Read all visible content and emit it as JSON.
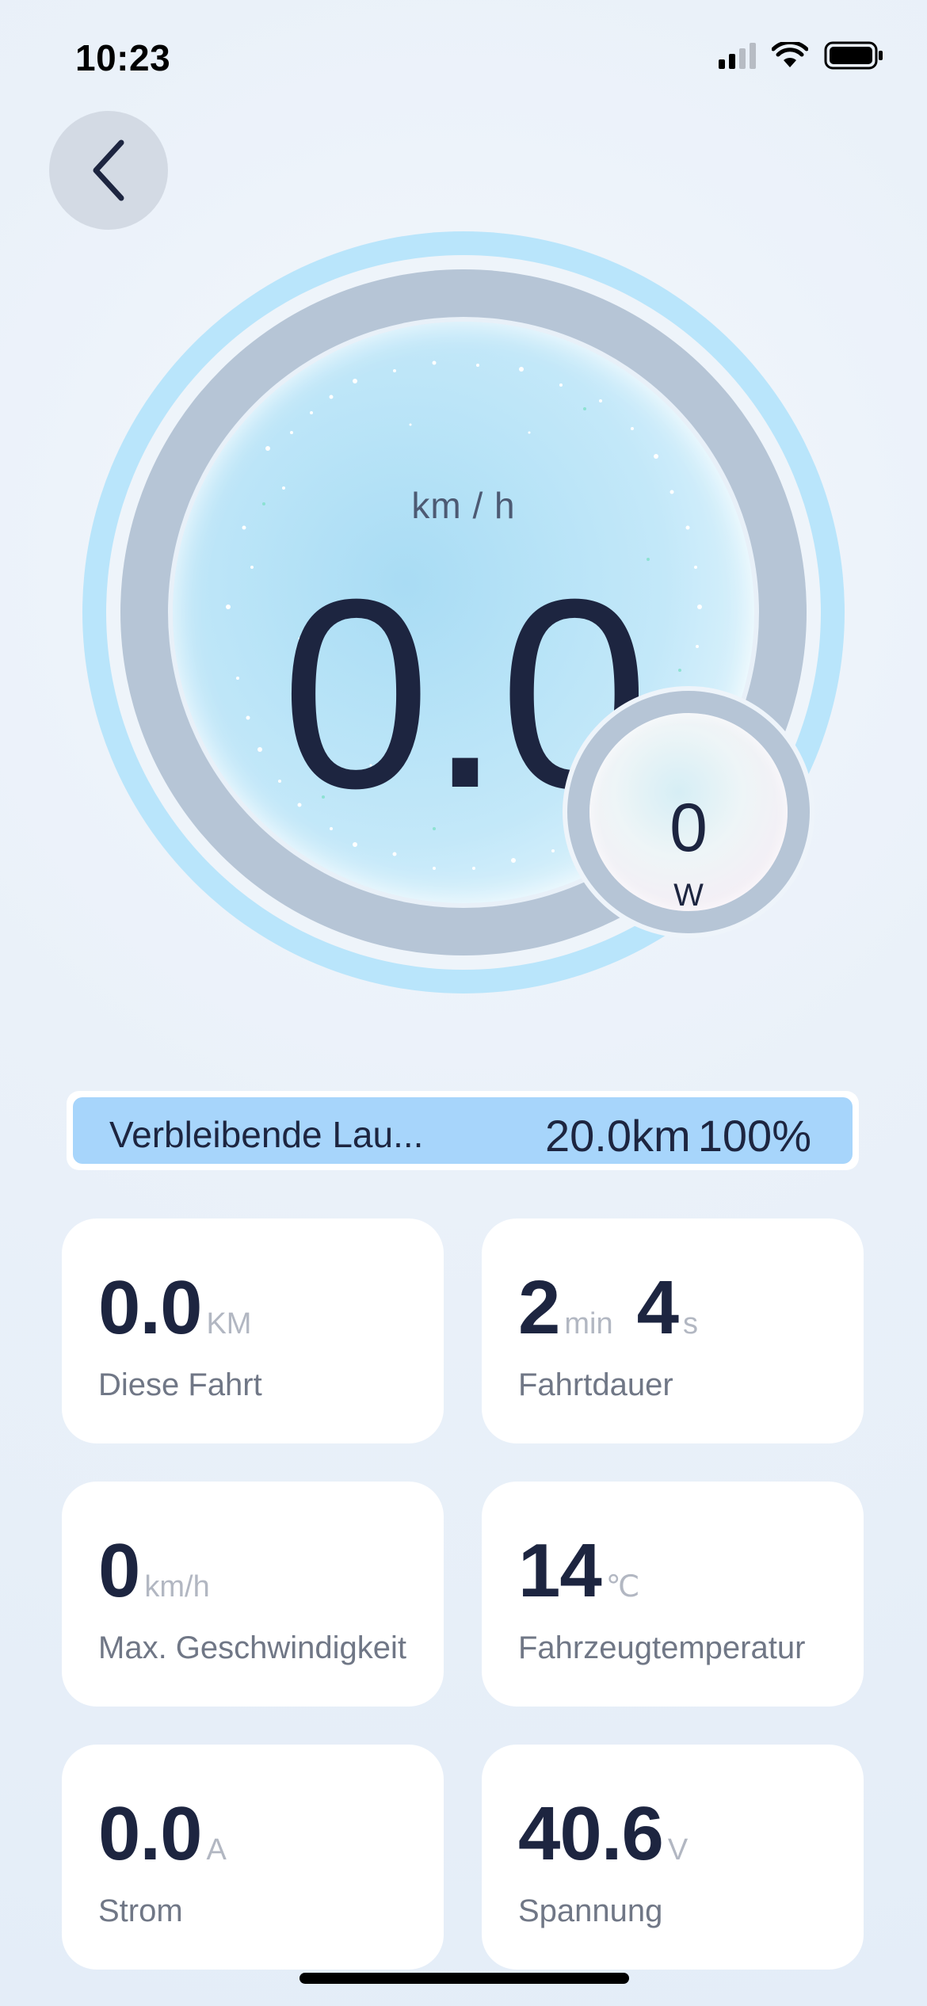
{
  "status_bar": {
    "time": "10:23"
  },
  "navigation": {
    "back_icon": "chevron-left-icon"
  },
  "speedometer": {
    "unit": "km / h",
    "value": "0.0"
  },
  "power": {
    "value": "0",
    "unit": "W"
  },
  "range": {
    "label": "Verbleibende Lau...",
    "distance": "20.0km",
    "battery_percent": "100%",
    "battery_level": 1.0
  },
  "stats": {
    "trip_distance": {
      "value": "0.0",
      "unit": "KM",
      "label": "Diese Fahrt"
    },
    "trip_duration": {
      "minutes": "2",
      "minutes_unit": "min",
      "seconds": "4",
      "seconds_unit": "s",
      "label": "Fahrtdauer"
    },
    "max_speed": {
      "value": "0",
      "unit": "km/h",
      "label": "Max. Geschwindigkeit"
    },
    "temperature": {
      "value": "14",
      "unit": "℃",
      "label": "Fahrzeugtemperatur"
    },
    "current": {
      "value": "0.0",
      "unit": "A",
      "label": "Strom"
    },
    "voltage": {
      "value": "40.6",
      "unit": "V",
      "label": "Spannung"
    }
  },
  "colors": {
    "accent_light_blue": "#a7d5fb",
    "text_dark": "#1d2540",
    "unit_gray": "#b2b7c2"
  }
}
